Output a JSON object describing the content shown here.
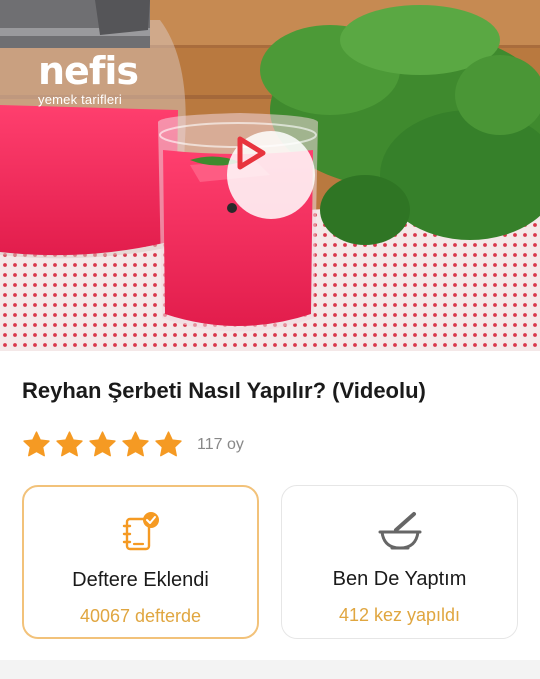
{
  "hero": {
    "logo_main": "nefis",
    "logo_sub": "yemek tarifleri",
    "play_icon": "play-icon"
  },
  "recipe": {
    "title": "Reyhan Şerbeti Nasıl Yapılır? (Videolu)",
    "rating_stars": 5,
    "votes": "117 oy"
  },
  "actions": {
    "notebook": {
      "label": "Deftere Eklendi",
      "count": "40067 defterde",
      "icon": "notebook-added-icon"
    },
    "made_it": {
      "label": "Ben De Yaptım",
      "count": "412 kez yapıldı",
      "icon": "mortar-pestle-icon"
    }
  },
  "colors": {
    "accent": "#f59a23",
    "accent_light": "#f2c27a",
    "count_text": "#e0a640",
    "play_red": "#e8343e"
  }
}
